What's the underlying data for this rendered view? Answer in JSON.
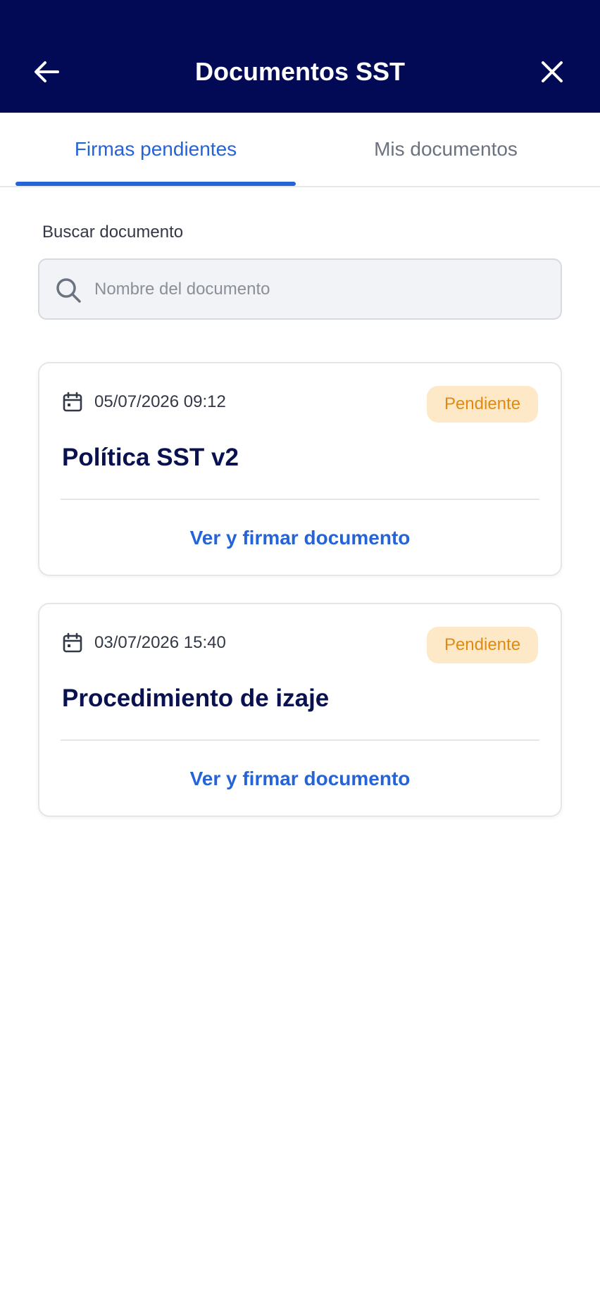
{
  "header": {
    "title": "Documentos SST",
    "back_icon": "arrow-left-icon",
    "close_icon": "close-icon",
    "background_color": "#030a55"
  },
  "tabs": [
    {
      "label": "Firmas pendientes",
      "active": true
    },
    {
      "label": "Mis documentos",
      "active": false
    }
  ],
  "search": {
    "label": "Buscar documento",
    "placeholder": "Nombre del documento",
    "value": "",
    "icon": "search-icon"
  },
  "documents": [
    {
      "date": "05/07/2026 09:12",
      "status": "Pendiente",
      "title": "Política SST v2",
      "action_label": "Ver y firmar documento"
    },
    {
      "date": "03/07/2026 15:40",
      "status": "Pendiente",
      "title": "Procedimiento de izaje",
      "action_label": "Ver y firmar documento"
    }
  ],
  "colors": {
    "accent": "#2563d9",
    "title_text": "#0a1150",
    "badge_bg": "#fde9c8",
    "badge_text": "#e08a12"
  }
}
